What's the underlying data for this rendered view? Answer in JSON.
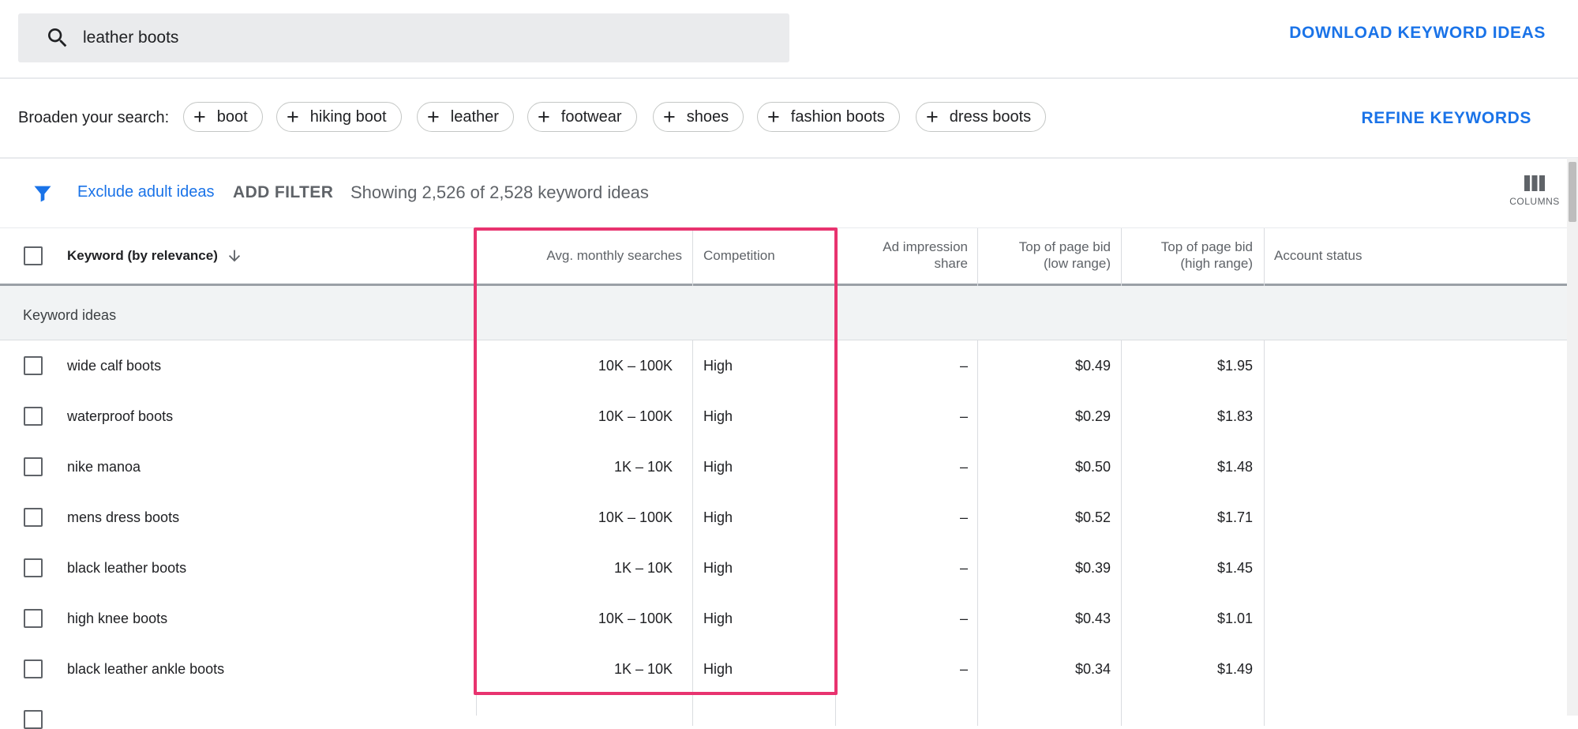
{
  "search": {
    "value": "leather boots"
  },
  "actions": {
    "download": "DOWNLOAD KEYWORD IDEAS",
    "refine": "REFINE KEYWORDS"
  },
  "broaden": {
    "label": "Broaden your search:",
    "chips": [
      "boot",
      "hiking boot",
      "leather",
      "footwear",
      "shoes",
      "fashion boots",
      "dress boots"
    ]
  },
  "filters": {
    "exclude": "Exclude adult ideas",
    "add_filter": "ADD FILTER",
    "showing": "Showing 2,526 of 2,528 keyword ideas",
    "columns": "COLUMNS"
  },
  "table": {
    "headers": {
      "keyword": "Keyword (by relevance)",
      "avg": "Avg. monthly searches",
      "competition": "Competition",
      "impr_1": "Ad impression",
      "impr_2": "share",
      "low_1": "Top of page bid",
      "low_2": "(low range)",
      "high_1": "Top of page bid",
      "high_2": "(high range)",
      "account": "Account status"
    },
    "group_label": "Keyword ideas",
    "rows": [
      {
        "keyword": "wide calf boots",
        "avg": "10K – 100K",
        "competition": "High",
        "impression": "–",
        "low": "$0.49",
        "high": "$1.95"
      },
      {
        "keyword": "waterproof boots",
        "avg": "10K – 100K",
        "competition": "High",
        "impression": "–",
        "low": "$0.29",
        "high": "$1.83"
      },
      {
        "keyword": "nike manoa",
        "avg": "1K – 10K",
        "competition": "High",
        "impression": "–",
        "low": "$0.50",
        "high": "$1.48"
      },
      {
        "keyword": "mens dress boots",
        "avg": "10K – 100K",
        "competition": "High",
        "impression": "–",
        "low": "$0.52",
        "high": "$1.71"
      },
      {
        "keyword": "black leather boots",
        "avg": "1K – 10K",
        "competition": "High",
        "impression": "–",
        "low": "$0.39",
        "high": "$1.45"
      },
      {
        "keyword": "high knee boots",
        "avg": "10K – 100K",
        "competition": "High",
        "impression": "–",
        "low": "$0.43",
        "high": "$1.01"
      },
      {
        "keyword": "black leather ankle boots",
        "avg": "1K – 10K",
        "competition": "High",
        "impression": "–",
        "low": "$0.34",
        "high": "$1.49"
      }
    ]
  },
  "colors": {
    "accent": "#1a73e8",
    "highlight": "#e8336f"
  }
}
